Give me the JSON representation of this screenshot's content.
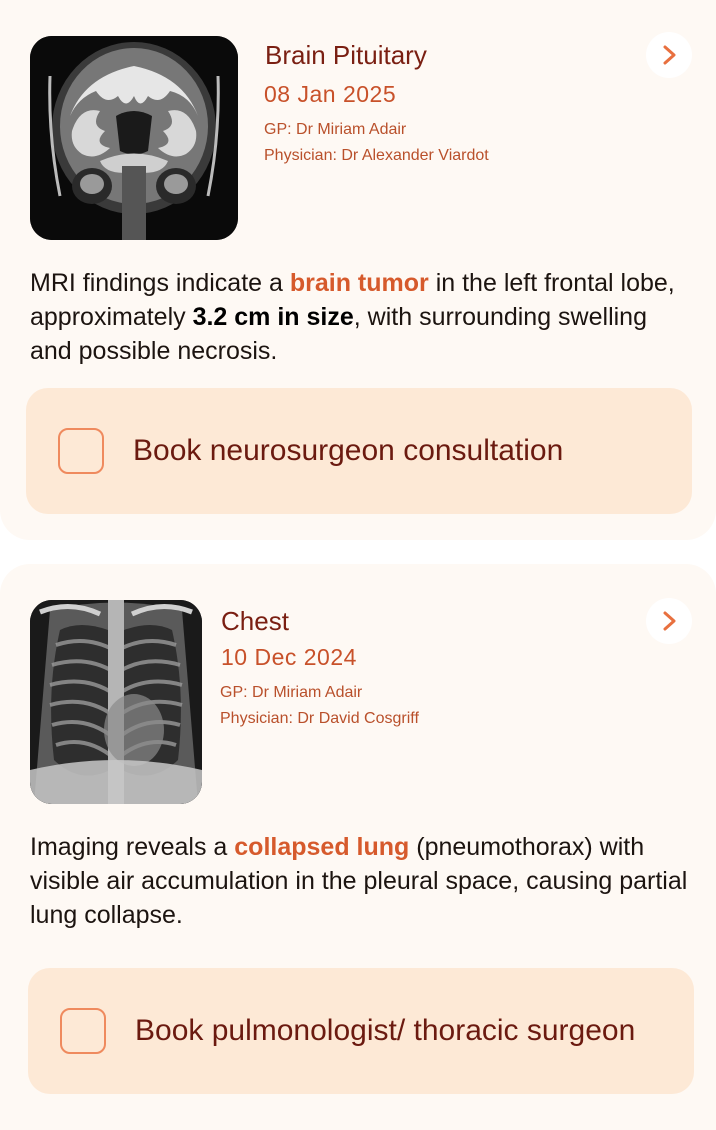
{
  "records": [
    {
      "title": "Brain Pituitary",
      "date": "08 Jan 2025",
      "gp": "GP: Dr Miriam Adair",
      "physician": "Physician: Dr Alexander Viardot",
      "image_icon": "mri-brain-scan",
      "description": {
        "prefix": "MRI findings indicate a ",
        "highlight": "brain tumor",
        "middle": " in the left frontal lobe, approximately ",
        "bold": "3.2 cm in size",
        "suffix": ", with surrounding swelling and possible necrosis."
      },
      "task_label": "Book neurosurgeon consultation"
    },
    {
      "title": "Chest",
      "date": "10 Dec 2024",
      "gp": "GP: Dr Miriam Adair",
      "physician": "Physician: Dr David Cosgriff",
      "image_icon": "chest-xray",
      "description": {
        "prefix": "Imaging reveals a ",
        "highlight": "collapsed lung",
        "suffix": " (pneumothorax) with visible air accumulation in the pleural space, causing partial lung collapse."
      },
      "task_label": "Book pulmonologist/ thoracic surgeon"
    }
  ],
  "colors": {
    "card_bg": "#fef9f4",
    "title": "#7a1f12",
    "accent": "#d65a2c",
    "task_bg": "#fde9d6",
    "checkbox_border": "#ef8a5e"
  },
  "icons": {
    "chevron": "chevron-right-icon"
  }
}
